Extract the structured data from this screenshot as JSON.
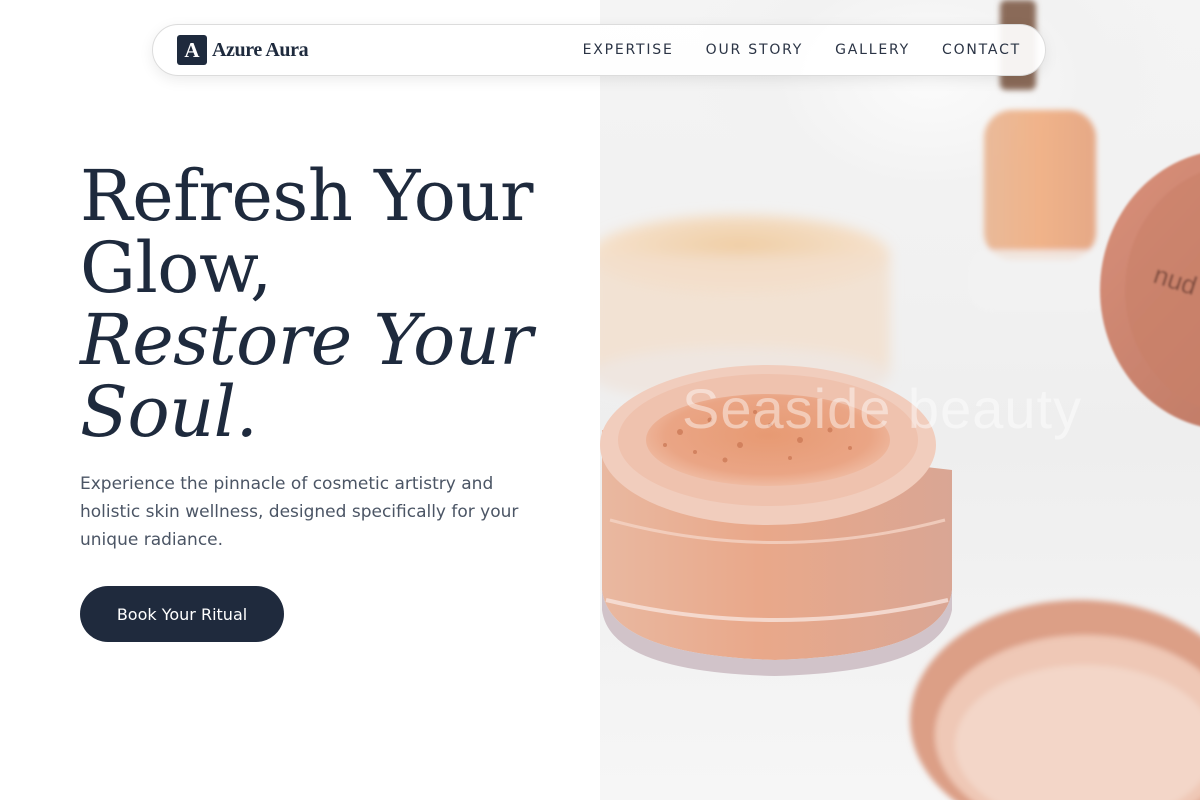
{
  "brand": {
    "logo_letter": "A",
    "name": "Azure Aura"
  },
  "nav": {
    "items": [
      "EXPERTISE",
      "OUR STORY",
      "GALLERY",
      "CONTACT"
    ]
  },
  "hero": {
    "headline_line1": "Refresh Your",
    "headline_line2": "Glow,",
    "headline_line3": "Restore Your",
    "headline_line4": "Soul.",
    "subtitle": "Experience the pinnacle of cosmetic artistry and holistic skin wellness, designed specifically for your unique radiance.",
    "cta_label": "Book Your Ritual"
  },
  "image": {
    "description_icon": "cosmetic-powder-jar-photo",
    "watermark": "Seaside beauty",
    "lid_print": "nud"
  },
  "colors": {
    "navy": "#1e2a3d",
    "body_text": "#4b5565",
    "powder": "#e8a783"
  }
}
